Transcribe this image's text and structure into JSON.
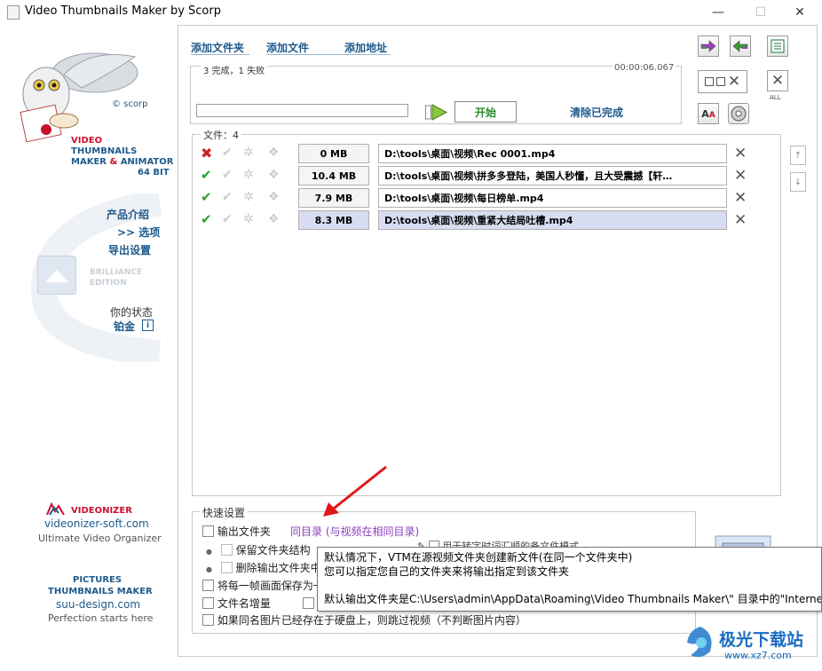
{
  "window": {
    "title": "Video Thumbnails Maker by Scorp",
    "minimize": "—",
    "maximize": "☐",
    "close": "✕"
  },
  "brand": {
    "scorp": "© scorp",
    "line1": "VIDEO",
    "line2": "THUMBNAILS",
    "line3a": "MAKER",
    "line3b": "&",
    "line3c": "ANIMATOR",
    "line4": "64 BIT",
    "accent": "#c8102e",
    "blue": "#1e5a8c"
  },
  "nav": {
    "product": "产品介绍",
    "options": ">> 选项",
    "export": "导出设置"
  },
  "edition": {
    "line1": "BRILLIANCE",
    "line2": "EDITION"
  },
  "status": {
    "label": "你的状态",
    "value": "铂金",
    "info": "i"
  },
  "ads": {
    "videonizer": "VIDEONIZER",
    "videonizer_site": "videonizer-soft.com",
    "videonizer_tag": "Ultimate Video Organizer",
    "ptm1": "PICTURES",
    "ptm2": "THUMBNAILS MAKER",
    "ptm_site": "suu-design.com",
    "ptm_tag": "Perfection starts here"
  },
  "toolbar": {
    "add_folder": "添加文件夹",
    "add_file": "添加文件",
    "add_url": "添加地址",
    "all_label": "ALL"
  },
  "progress": {
    "summary": "3  完成，1 失败",
    "elapsed": "00:00:06.067",
    "start": "开始",
    "clear_done": "清除已完成"
  },
  "files": {
    "label": "文件：4",
    "rows": [
      {
        "status": "fail",
        "size": "0 MB",
        "path": "D:\\tools\\桌面\\视频\\Rec 0001.mp4",
        "selected": false
      },
      {
        "status": "ok",
        "size": "10.4 MB",
        "path": "D:\\tools\\桌面\\视频\\拼多多登陆，美国人秒懂，且大受震撼【轩…",
        "selected": false
      },
      {
        "status": "ok",
        "size": "7.9 MB",
        "path": "D:\\tools\\桌面\\视频\\每日榜单.mp4",
        "selected": false
      },
      {
        "status": "ok",
        "size": "8.3 MB",
        "path": "D:\\tools\\桌面\\视频\\重紧大结局吐槽.mp4",
        "selected": true
      }
    ]
  },
  "quick": {
    "title": "快速设置",
    "output_folder": "输出文件夹",
    "output_link": "同目录 (与视频在相同目录)",
    "keep_structure": "保留文件夹结构",
    "delete_output": "删除输出文件夹中",
    "save_each_frame": "将每一帧画面保存为一",
    "filename_increment": "文件名增量",
    "skip_existing": "如果同名图片已经存在于硬盘上，则跳过视频（不判断图片内容）",
    "partial_text": "用于转字时词汇顺的备文件模式"
  },
  "tooltip": {
    "line1": "默认情况下，VTM在源视频文件夹创建新文件(在同一个文件夹中)",
    "line2": "您可以指定您自己的文件夹来将输出指定到该文件夹",
    "line3": "默认输出文件夹是C:\\Users\\admin\\AppData\\Roaming\\Video Thumbnails Maker\\\" 目录中的\"Internet"
  },
  "watermark": {
    "text": "极光下载站",
    "url": "www.xz7.com"
  }
}
